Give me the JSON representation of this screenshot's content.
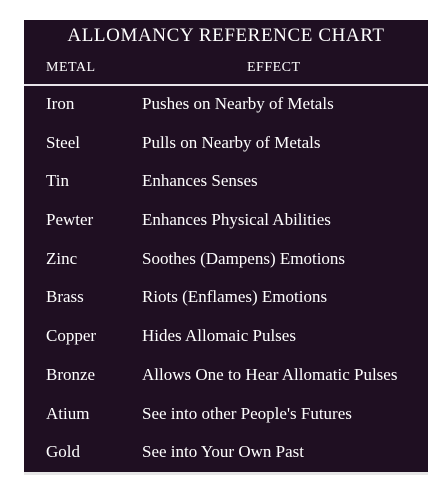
{
  "chart": {
    "title": "ALLOMANCY REFERENCE CHART",
    "columns": {
      "metal": "METAL",
      "effect": "EFFECT"
    },
    "rows": [
      {
        "metal": "Iron",
        "effect": "Pushes on Nearby of Metals"
      },
      {
        "metal": "Steel",
        "effect": "Pulls on Nearby of Metals"
      },
      {
        "metal": "Tin",
        "effect": "Enhances Senses"
      },
      {
        "metal": "Pewter",
        "effect": "Enhances Physical Abilities"
      },
      {
        "metal": "Zinc",
        "effect": "Soothes (Dampens) Emotions"
      },
      {
        "metal": "Brass",
        "effect": "Riots (Enflames) Emotions"
      },
      {
        "metal": "Copper",
        "effect": "Hides Allomaic Pulses"
      },
      {
        "metal": "Bronze",
        "effect": "Allows One to Hear Allomatic Pulses"
      },
      {
        "metal": "Atium",
        "effect": "See into other People's Futures"
      },
      {
        "metal": "Gold",
        "effect": "See into Your Own Past"
      }
    ]
  },
  "colors": {
    "background": "#1f0f22",
    "text": "#ffffff",
    "divider": "#e8e4ea"
  }
}
